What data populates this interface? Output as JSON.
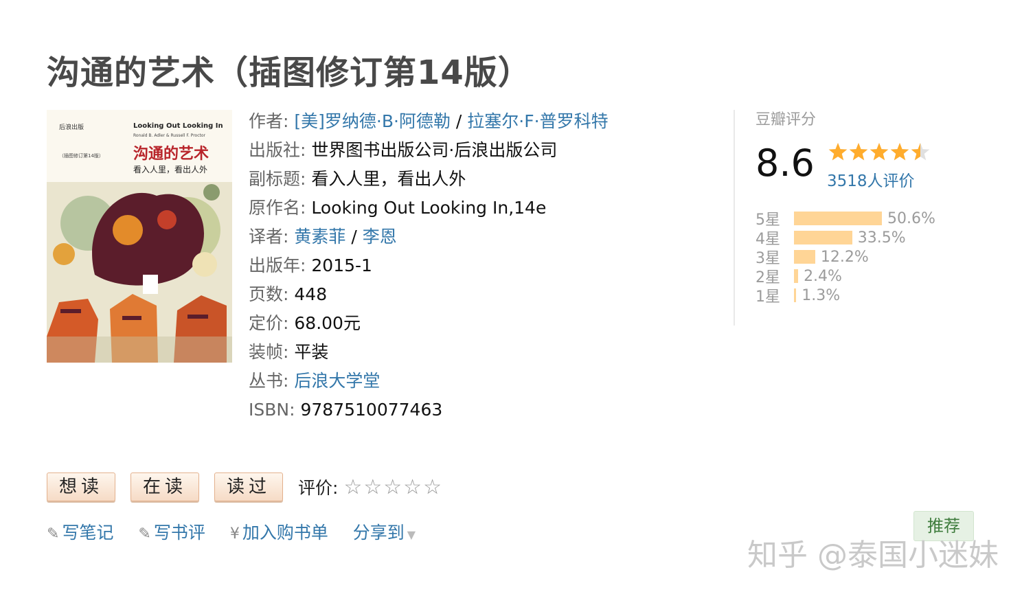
{
  "book": {
    "title": "沟通的艺术（插图修订第14版）"
  },
  "cover": {
    "text_top_right": "Looking Out Looking In",
    "text_authors": "Ronald B. Adler & Russell F. Proctor",
    "text_title": "沟通的艺术",
    "text_subtitle": "看入人里，看出人外",
    "text_publisher": "后浪出版",
    "text_edition": "（插图修订第14版）"
  },
  "info": {
    "author_label": "作者:",
    "author_1": "[美]罗纳德·B·阿德勒",
    "author_sep": "/",
    "author_2": "拉塞尔·F·普罗科特",
    "publisher_label": "出版社:",
    "publisher": "世界图书出版公司·后浪出版公司",
    "subtitle_label": "副标题:",
    "subtitle": "看入人里，看出人外",
    "original_title_label": "原作名:",
    "original_title": "Looking Out Looking In,14e",
    "translator_label": "译者:",
    "translator_1": "黄素菲",
    "translator_sep": "/",
    "translator_2": "李恩",
    "year_label": "出版年:",
    "year": "2015-1",
    "pages_label": "页数:",
    "pages": "448",
    "price_label": "定价:",
    "price": "68.00元",
    "binding_label": "装帧:",
    "binding": "平装",
    "series_label": "丛书:",
    "series": "后浪大学堂",
    "isbn_label": "ISBN:",
    "isbn": "9787510077463"
  },
  "rating": {
    "label": "豆瓣评分",
    "score": "8.6",
    "stars_value": 4.5,
    "count_text": "3518人评价",
    "star_color": "#ffac2d",
    "bar_color": "#ffd596",
    "distribution": [
      {
        "label": "5星",
        "percent_text": "50.6%",
        "percent": 50.6
      },
      {
        "label": "4星",
        "percent_text": "33.5%",
        "percent": 33.5
      },
      {
        "label": "3星",
        "percent_text": "12.2%",
        "percent": 12.2
      },
      {
        "label": "2星",
        "percent_text": "2.4%",
        "percent": 2.4
      },
      {
        "label": "1星",
        "percent_text": "1.3%",
        "percent": 1.3
      }
    ]
  },
  "buttons": {
    "want": "想读",
    "reading": "在读",
    "read": "读过",
    "rate_label": "评价:"
  },
  "actions": {
    "note": "写笔记",
    "review": "写书评",
    "cart": "加入购书单",
    "share": "分享到",
    "pencil_icon": "✎",
    "yen_icon": "¥",
    "caret_icon": "▼"
  },
  "recommend": "推荐",
  "watermark": "知乎 @泰国小迷妹"
}
